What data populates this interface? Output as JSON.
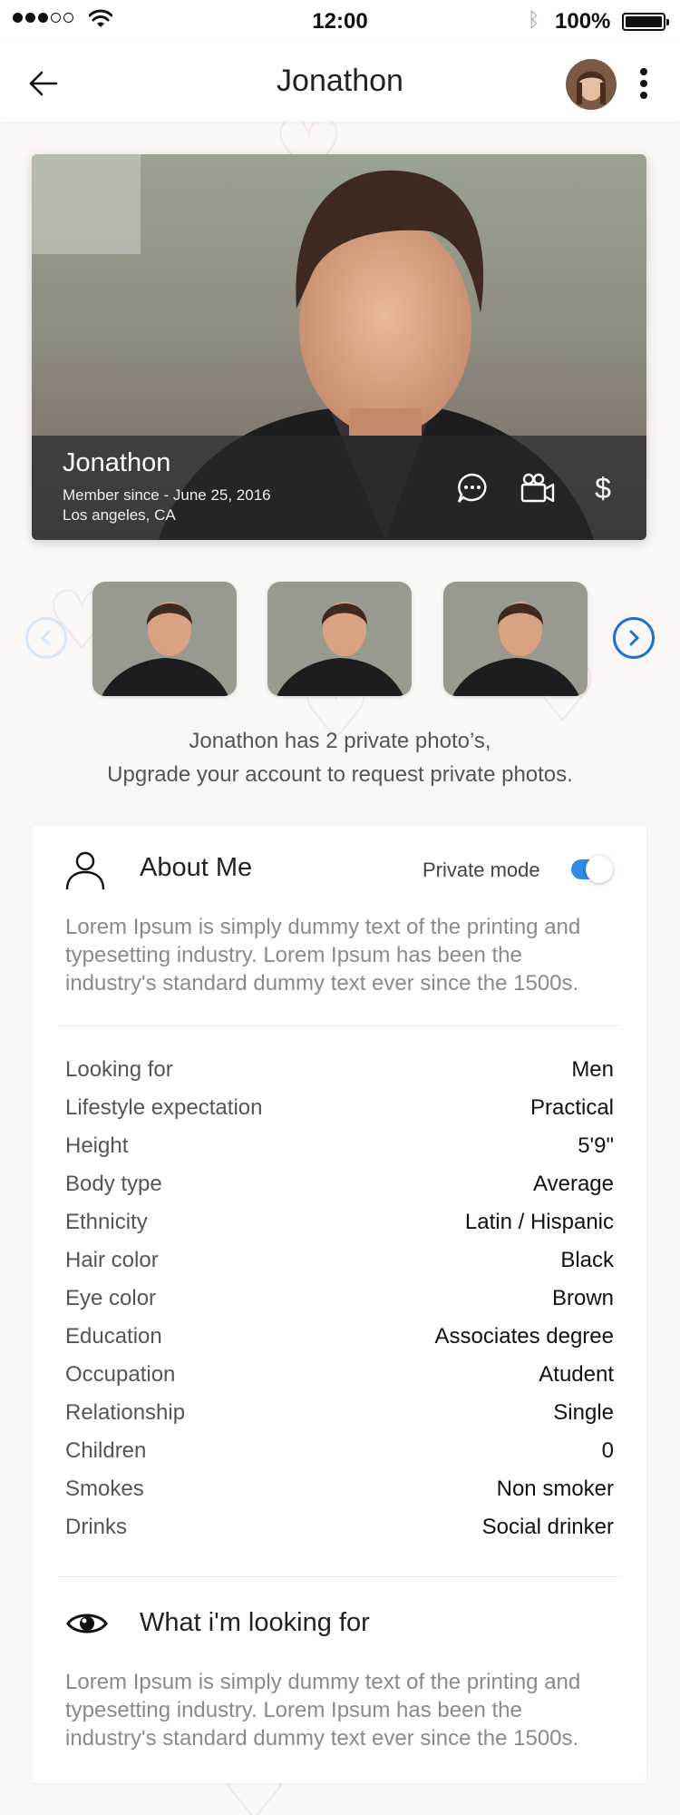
{
  "status_bar": {
    "time": "12:00",
    "battery_text": "100%",
    "icons": [
      "signal-dots-icon",
      "wifi-icon",
      "bluetooth-icon",
      "battery-icon"
    ]
  },
  "header": {
    "title": "Jonathon",
    "icons": [
      "back-arrow-icon",
      "avatar",
      "more-vertical-icon"
    ]
  },
  "hero": {
    "name": "Jonathon",
    "member_since": "Member since - June 25, 2016",
    "location": "Los angeles, CA",
    "actions": [
      "chat-bubble-icon",
      "video-camera-icon",
      "dollar-icon"
    ],
    "money_symbol": "$"
  },
  "gallery": {
    "thumbnail_count": 3,
    "note_line1": "Jonathon has 2 private photo’s,",
    "note_line2": "Upgrade your account to request private photos."
  },
  "about": {
    "title": "About Me",
    "private_mode_label": "Private mode",
    "private_mode_on": true,
    "text": "Lorem Ipsum is simply dummy text of the printing and typesetting industry. Lorem Ipsum has been the industry's standard dummy text ever since the 1500s."
  },
  "details": [
    {
      "label": "Looking for",
      "value": "Men"
    },
    {
      "label": "Lifestyle expectation",
      "value": "Practical"
    },
    {
      "label": "Height",
      "value": "5'9\""
    },
    {
      "label": "Body type",
      "value": "Average"
    },
    {
      "label": "Ethnicity",
      "value": "Latin / Hispanic"
    },
    {
      "label": "Hair color",
      "value": "Black"
    },
    {
      "label": "Eye color",
      "value": "Brown"
    },
    {
      "label": "Education",
      "value": "Associates degree"
    },
    {
      "label": "Occupation",
      "value": "Atudent"
    },
    {
      "label": "Relationship",
      "value": "Single"
    },
    {
      "label": "Children",
      "value": "0"
    },
    {
      "label": "Smokes",
      "value": "Non smoker"
    },
    {
      "label": "Drinks",
      "value": "Social drinker"
    }
  ],
  "looking_for": {
    "title": "What i'm looking for",
    "text": "Lorem Ipsum is simply dummy text of the printing and typesetting industry. Lorem Ipsum has been the industry's standard dummy text ever since the 1500s."
  },
  "colors": {
    "accent_blue": "#1e73c8",
    "toggle_blue": "#2f8be6",
    "background": "#fcf7f7"
  }
}
